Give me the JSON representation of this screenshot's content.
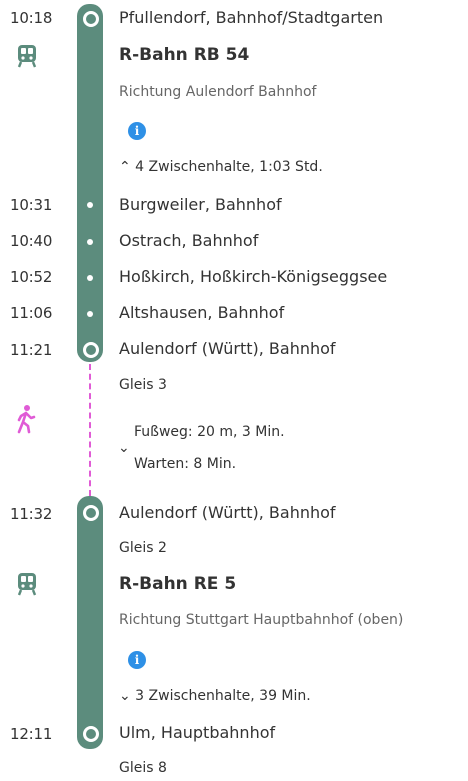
{
  "leg1": {
    "departure_time": "10:18",
    "departure_stop": "Pfullendorf, Bahnhof/Stadtgarten",
    "mode_icon": "train-icon",
    "line": "R-Bahn RB 54",
    "direction": "Richtung Aulendorf Bahnhof",
    "info_icon": "info-icon",
    "intermediate_toggle": "⌃ 4 Zwischenhalte, 1:03 Std.",
    "intermediate_stops": [
      {
        "time": "10:31",
        "name": "Burgweiler, Bahnhof"
      },
      {
        "time": "10:40",
        "name": "Ostrach, Bahnhof"
      },
      {
        "time": "10:52",
        "name": "Hoßkirch, Hoßkirch-Königseggsee"
      },
      {
        "time": "11:06",
        "name": "Altshausen, Bahnhof"
      }
    ],
    "arrival_time": "11:21",
    "arrival_stop": "Aulendorf (Württ), Bahnhof",
    "arrival_platform": "Gleis 3"
  },
  "walk": {
    "icon": "walking-person-icon",
    "chevron": "⌄",
    "footpath": "Fußweg: 20 m, 3 Min.",
    "wait": "Warten: 8 Min."
  },
  "leg2": {
    "departure_time": "11:32",
    "departure_stop": "Aulendorf (Württ), Bahnhof",
    "departure_platform": "Gleis 2",
    "mode_icon": "train-icon",
    "line": "R-Bahn RE 5",
    "direction": "Richtung Stuttgart Hauptbahnhof (oben)",
    "info_icon": "info-icon",
    "intermediate_toggle": "⌄ 3 Zwischenhalte, 39 Min.",
    "arrival_time": "12:11",
    "arrival_stop": "Ulm, Hauptbahnhof",
    "arrival_platform": "Gleis 8"
  },
  "colors": {
    "route_bar": "#5c8c7d",
    "walk_path": "#e05bd6",
    "info": "#2e90e6",
    "text": "#333333",
    "muted": "#666666"
  }
}
